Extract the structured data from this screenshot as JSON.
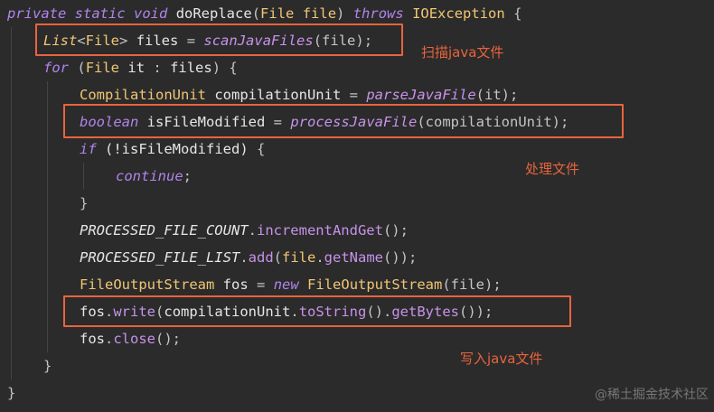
{
  "code": {
    "l1": {
      "private": "private",
      "static": "static",
      "void": "void",
      "method": "doReplace",
      "open": "(",
      "File": "File",
      "param": "file",
      "close": ")",
      "throws": "throws",
      "IOException": "IOException",
      "brace": "{"
    },
    "l2": {
      "List": "List",
      "lt": "<",
      "File": "File",
      "gt": ">",
      "var": "files",
      "eq": "=",
      "call": "scanJavaFiles",
      "args": "(file);"
    },
    "l3": {
      "for": "for",
      "open": "(",
      "File": "File",
      "it": "it",
      "colon": ":",
      "files": "files",
      "close": ")",
      "brace": "{"
    },
    "l4": {
      "type": "CompilationUnit",
      "var": "compilationUnit",
      "eq": "=",
      "call": "parseJavaFile",
      "args": "(it);"
    },
    "l5": {
      "boolean": "boolean",
      "var": "isFileModified",
      "eq": "=",
      "call": "processJavaFile",
      "args": "(compilationUnit);"
    },
    "l6": {
      "if": "if",
      "cond": "(!isFileModified)",
      "brace": "{"
    },
    "l7": {
      "continue": "continue",
      "semi": ";"
    },
    "l8": {
      "brace": "}"
    },
    "l9": {
      "const": "PROCESSED_FILE_COUNT",
      "dot": ".",
      "method": "incrementAndGet",
      "tail": "();"
    },
    "l10": {
      "const": "PROCESSED_FILE_LIST",
      "dot": ".",
      "method": "add",
      "open": "(",
      "arg": "file",
      "dot2": ".",
      "method2": "getName",
      "tail": "());"
    },
    "l11": {
      "type": "FileOutputStream",
      "var": "fos",
      "eq": "=",
      "new": "new",
      "ctor": "FileOutputStream",
      "args": "(file);"
    },
    "l12": {
      "var": "fos",
      "dot": ".",
      "method": "write",
      "open": "(",
      "arg": "compilationUnit",
      "dot2": ".",
      "m2": "toString",
      "mid": "().",
      "m3": "getBytes",
      "tail": "());"
    },
    "l13": {
      "var": "fos",
      "dot": ".",
      "method": "close",
      "tail": "();"
    },
    "l14": {
      "brace": "}"
    },
    "l15": {
      "brace": "}"
    }
  },
  "annotations": {
    "scan": "扫描java文件",
    "process": "处理文件",
    "write": "写入java文件"
  },
  "watermark": "@稀土掘金技术社区",
  "colors": {
    "highlight": "#e8643d",
    "background": "#2b2b2b"
  }
}
